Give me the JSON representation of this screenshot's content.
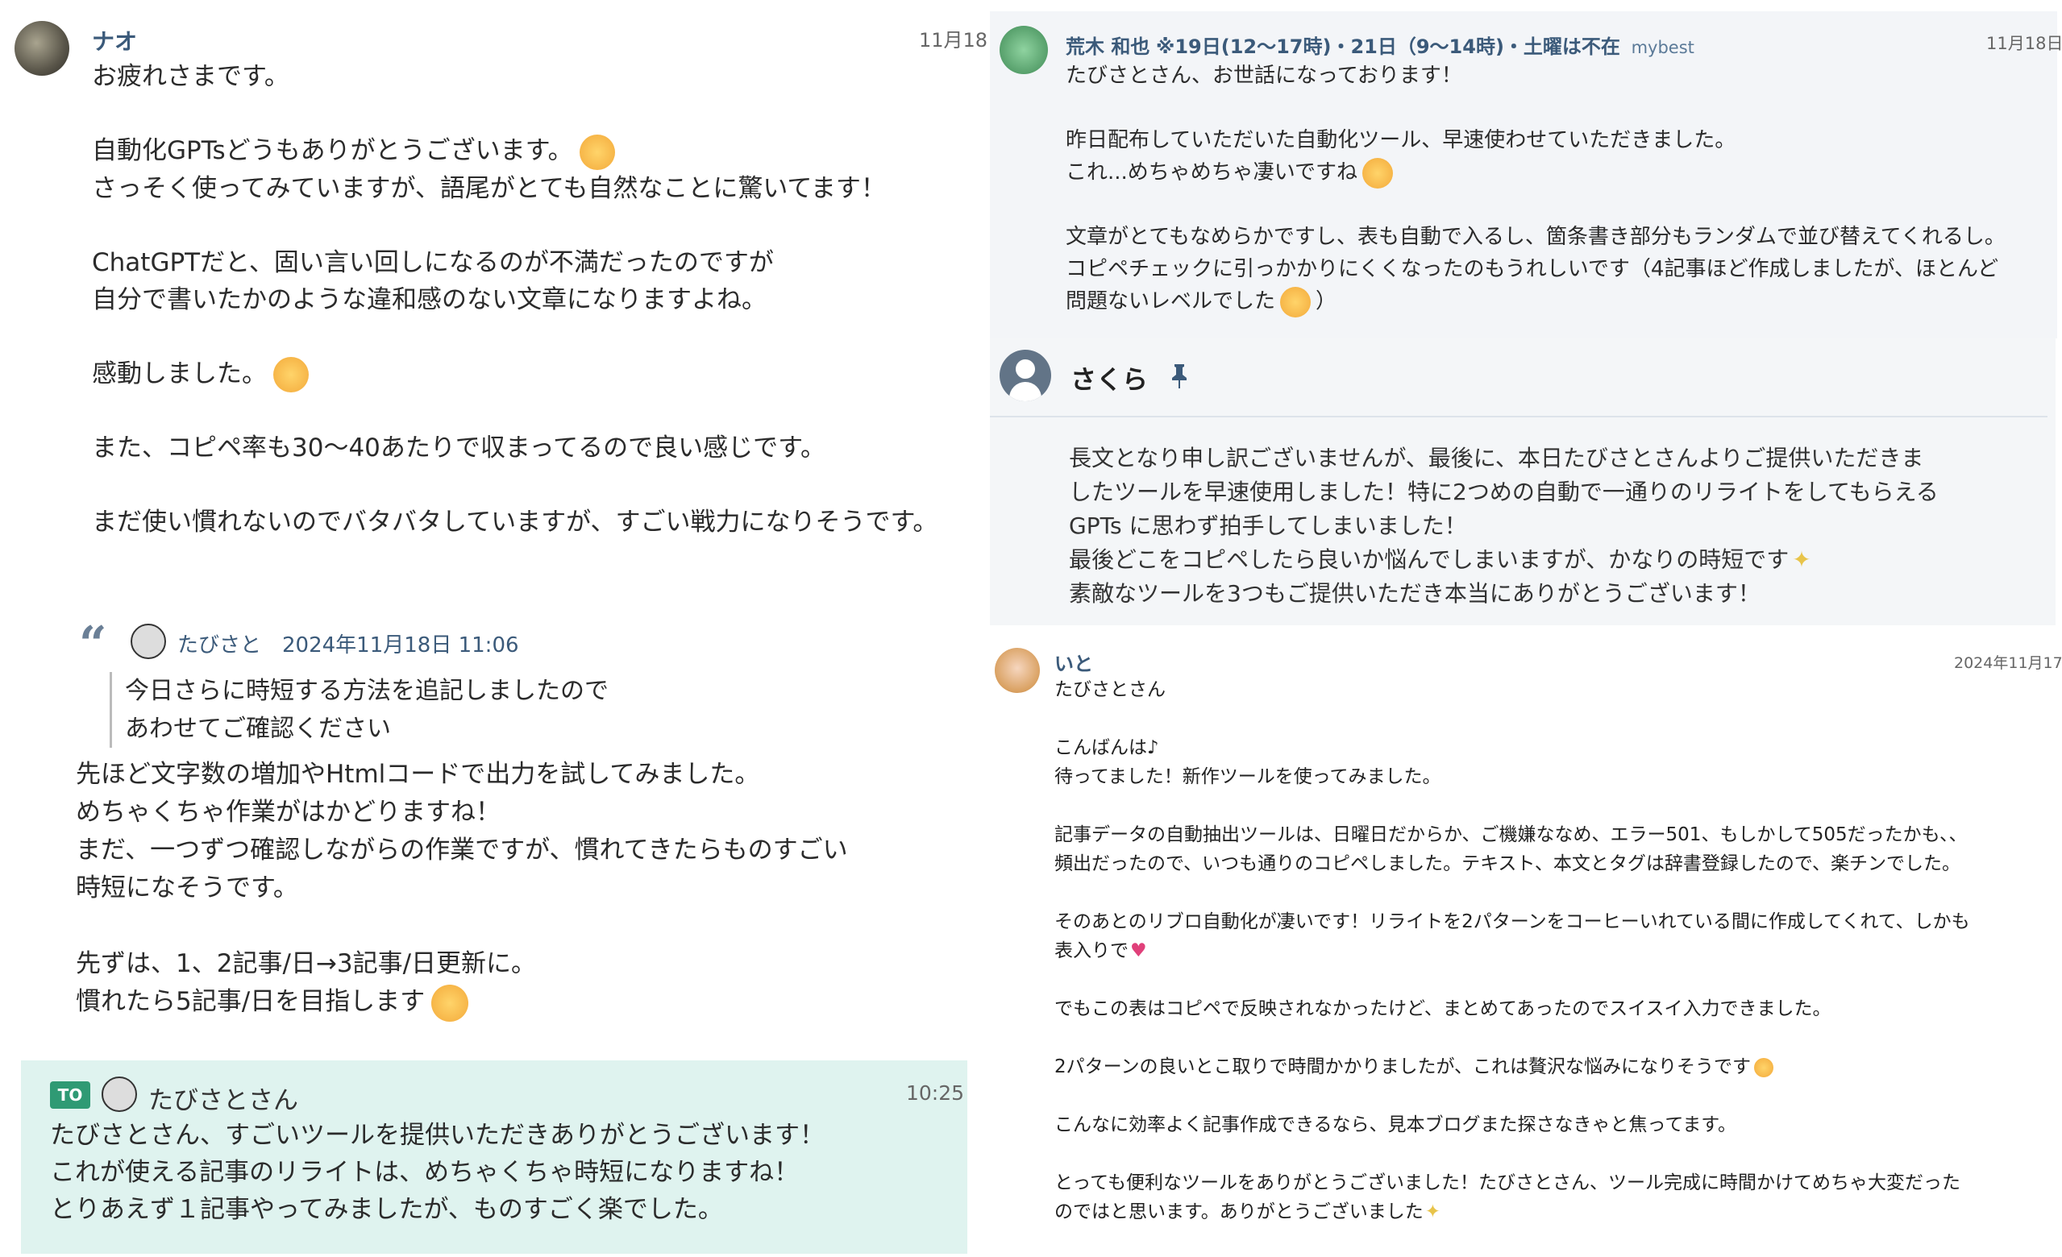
{
  "p1": {
    "name": "ナオ",
    "time": "11月18日",
    "greeting": "お疲れさまです。",
    "line1": "自動化GPTsどうもありがとうございます。",
    "line2": "さっそく使ってみていますが、語尾がとても自然なことに驚いてます！",
    "para2": "ChatGPTだと、固い言い回しになるのが不満だったのですが\n自分で書いたかのような違和感のない文章になりますよね。",
    "line3": "感動しました。",
    "para4": "また、コピペ率も30〜40あたりで収まってるので良い感じです。",
    "para5": "まだ使い慣れないのでバタバタしていますが、すごい戦力になりそうです。"
  },
  "p2": {
    "quote_mark": "“",
    "quote_author": "たびさと",
    "quote_time": "2024年11月18日 11:06",
    "quote_body": "今日さらに時短する方法を追記しましたので\nあわせてご確認ください",
    "body": "先ほど文字数の増加やHtmlコードで出力を試してみました。\nめちゃくちゃ作業がはかどりますね！\nまだ、一つずつ確認しながらの作業ですが、慣れてきたらものすごい\n時短になそうです。",
    "line_a": "先ずは、1、2記事/日→3記事/日更新に。",
    "line_b": "慣れたら5記事/日を目指します"
  },
  "p3": {
    "to_badge": "TO",
    "to_name": "たびさとさん",
    "time": "10:25",
    "body": "たびさとさん、すごいツールを提供いただきありがとうございます！\nこれが使える記事のリライトは、めちゃくちゃ時短になりますね！\nとりあえず１記事やってみましたが、ものすごく楽でした。"
  },
  "p4": {
    "name": "荒木 和也",
    "status": "※19日(12〜17時)・21日（9〜14時)・土曜は不在",
    "org": "mybest",
    "time": "11月18日",
    "line1": "たびさとさん、お世話になっております！",
    "line2": "昨日配布していただいた自動化ツール、早速使わせていただきました。",
    "line3": "これ...めちゃめちゃ凄いですね",
    "para3": "文章がとてもなめらかですし、表も自動で入るし、箇条書き部分もランダムで並び替えてくれるし。\nコピペチェックに引っかかりにくくなったのもうれしいです（4記事ほど作成しましたが、ほとんど",
    "line4": "問題ないレベルでした",
    "line4_end": "）"
  },
  "p5": {
    "name": "さくら",
    "body": "長文となり申し訳ございませんが、最後に、本日たびさとさんよりご提供いただきま\nしたツールを早速使用しました！特に2つめの自動で一通りのリライトをしてもらえる\nGPTs に思わず拍手してしまいました！",
    "line_last1": "最後どこをコピペしたら良いか悩んでしまいますが、かなりの時短です",
    "line_last2": "素敵なツールを3つもご提供いただき本当にありがとうございます！"
  },
  "p6": {
    "name": "いと",
    "time": "2024年11月17日",
    "l1": "たびさとさん",
    "l2": "こんばんは♪\n待ってました！新作ツールを使ってみました。",
    "l3": "記事データの自動抽出ツールは、日曜日だからか、ご機嫌ななめ、エラー501、もしかして505だったかも、、\n頻出だったので、いつも通りのコピペしました。テキスト、本文とタグは辞書登録したので、楽チンでした。",
    "l4a": "そのあとのリブロ自動化が凄いです！リライトを2パターンをコーヒーいれている間に作成してくれて、しかも",
    "l4b": "表入りで",
    "l5": "でもこの表はコピペで反映されなかったけど、まとめてあったのでスイスイ入力できました。",
    "l6": "2パターンの良いとこ取りで時間かかりましたが、これは贅沢な悩みになりそうです",
    "l7": "こんなに効率よく記事作成できるなら、見本ブログまた探さなきゃと焦ってます。",
    "l8a": "とっても便利なツールをありがとうございました！たびさとさん、ツール完成に時間かけてめちゃ大変だった",
    "l8b": "のではと思います。ありがとうございました"
  },
  "colors": {
    "name_blue": "#3b5a7a",
    "to_bg": "#dff3ef",
    "to_badge": "#2f9a74",
    "tile_bg": "#f3f5f8",
    "sakura_bg": "#f4f6f8"
  }
}
